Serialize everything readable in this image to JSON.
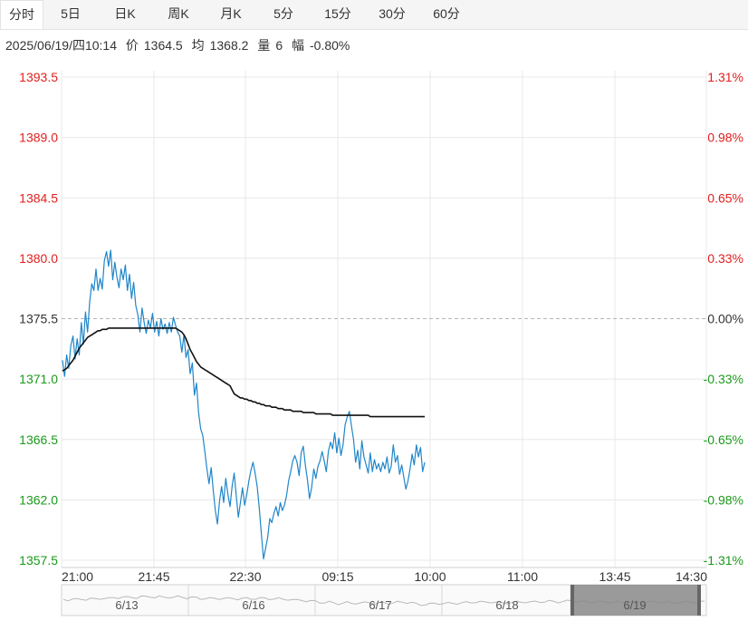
{
  "tabs": [
    {
      "label": "分时",
      "active": true
    },
    {
      "label": "5日",
      "active": false
    },
    {
      "label": "日K",
      "active": false
    },
    {
      "label": "周K",
      "active": false
    },
    {
      "label": "月K",
      "active": false
    },
    {
      "label": "5分",
      "active": false
    },
    {
      "label": "15分",
      "active": false
    },
    {
      "label": "30分",
      "active": false
    },
    {
      "label": "60分",
      "active": false
    }
  ],
  "info": {
    "datetime": "2025/06/19/四10:14",
    "price_label": "价",
    "price": "1364.5",
    "avg_label": "均",
    "avg": "1368.2",
    "vol_label": "量",
    "vol": "6",
    "change_label": "幅",
    "change": "-0.80%"
  },
  "colors": {
    "up": "#e0201e",
    "down": "#1a9a1a",
    "flat": "#333333",
    "price_line": "#1f86c9",
    "avg_line": "#111111",
    "grid": "#e8e8e8",
    "navigator_fill": "#888888"
  },
  "chart_data": {
    "type": "line",
    "prev_close": 1375.5,
    "ylim": [
      1357.5,
      1393.5
    ],
    "y_ticks_left": [
      "1393.5",
      "1389.0",
      "1384.5",
      "1380.0",
      "1375.5",
      "1371.0",
      "1366.5",
      "1362.0",
      "1357.5"
    ],
    "y_ticks_right": [
      "1.31%",
      "0.98%",
      "0.65%",
      "0.33%",
      "0.00%",
      "-0.33%",
      "-0.65%",
      "-0.98%",
      "-1.31%"
    ],
    "x_ticks": [
      "21:00",
      "21:45",
      "22:30",
      "09:15",
      "10:00",
      "11:00",
      "13:45",
      "14:30"
    ],
    "navigator_labels": [
      "6/13",
      "6/16",
      "6/17",
      "6/18",
      "6/19"
    ],
    "series": [
      {
        "values": [
          1372.4,
          1371.2,
          1372.8,
          1371.8,
          1373.5,
          1374.2,
          1372.5,
          1374.0,
          1372.8,
          1375.2,
          1373.6,
          1376.0,
          1374.5,
          1376.8,
          1378.1,
          1377.6,
          1379.2,
          1377.6,
          1378.5,
          1377.7,
          1379.8,
          1380.5,
          1379.4,
          1380.6,
          1378.4,
          1379.7,
          1378.6,
          1377.8,
          1379.2,
          1378.4,
          1379.5,
          1377.6,
          1378.8,
          1377.0,
          1378.2,
          1376.5,
          1375.8,
          1374.5,
          1376.3,
          1375.2,
          1374.4,
          1375.4,
          1374.8,
          1375.9,
          1374.5,
          1375.3,
          1374.2,
          1375.5,
          1374.7,
          1375.1,
          1374.4,
          1375.2,
          1374.5,
          1375.6,
          1375.0,
          1374.5,
          1374.2,
          1373.0,
          1374.3,
          1372.6,
          1373.2,
          1371.4,
          1372.2,
          1369.8,
          1370.7,
          1368.5,
          1367.3,
          1366.8,
          1365.6,
          1364.3,
          1363.2,
          1364.4,
          1362.7,
          1361.2,
          1360.2,
          1361.9,
          1363.0,
          1361.8,
          1363.6,
          1362.4,
          1361.5,
          1363.0,
          1364.0,
          1362.3,
          1360.7,
          1361.8,
          1362.9,
          1361.6,
          1362.4,
          1363.4,
          1364.2,
          1364.8,
          1364.0,
          1363.0,
          1361.4,
          1359.4,
          1357.6,
          1358.4,
          1359.2,
          1360.6,
          1360.3,
          1361.0,
          1361.5,
          1360.8,
          1361.8,
          1361.2,
          1361.6,
          1362.3,
          1363.4,
          1364.1,
          1364.9,
          1365.3,
          1364.8,
          1363.8,
          1365.5,
          1366.0,
          1364.6,
          1363.5,
          1362.1,
          1362.9,
          1364.3,
          1363.6,
          1364.5,
          1364.9,
          1365.6,
          1364.9,
          1364.1,
          1365.6,
          1366.3,
          1365.8,
          1367.0,
          1365.5,
          1366.6,
          1365.3,
          1366.1,
          1367.6,
          1368.2,
          1368.6,
          1367.5,
          1366.5,
          1364.8,
          1365.7,
          1364.3,
          1366.4,
          1365.2,
          1364.6,
          1364.0,
          1365.5,
          1364.1,
          1365.0,
          1364.3,
          1364.7,
          1364.1,
          1364.8,
          1364.3,
          1365.2,
          1364.0,
          1364.5,
          1366.1,
          1364.8,
          1365.3,
          1363.9,
          1364.6,
          1363.7,
          1362.8,
          1363.4,
          1364.3,
          1365.4,
          1364.6,
          1366.1,
          1365.2,
          1365.9,
          1364.1,
          1364.8
        ]
      },
      {
        "values": [
          1371.6,
          1371.7,
          1371.8,
          1372.0,
          1372.2,
          1372.4,
          1372.7,
          1373.0,
          1373.3,
          1373.5,
          1373.7,
          1373.9,
          1374.1,
          1374.2,
          1374.3,
          1374.4,
          1374.5,
          1374.6,
          1374.6,
          1374.7,
          1374.7,
          1374.7,
          1374.8,
          1374.8,
          1374.8,
          1374.8,
          1374.8,
          1374.8,
          1374.8,
          1374.8,
          1374.8,
          1374.8,
          1374.8,
          1374.8,
          1374.8,
          1374.8,
          1374.8,
          1374.8,
          1374.8,
          1374.8,
          1374.8,
          1374.8,
          1374.8,
          1374.8,
          1374.8,
          1374.8,
          1374.8,
          1374.8,
          1374.8,
          1374.8,
          1374.8,
          1374.8,
          1374.8,
          1374.8,
          1374.8,
          1374.7,
          1374.6,
          1374.5,
          1374.3,
          1374.0,
          1373.6,
          1373.2,
          1372.9,
          1372.6,
          1372.3,
          1372.1,
          1371.9,
          1371.8,
          1371.7,
          1371.6,
          1371.5,
          1371.4,
          1371.3,
          1371.2,
          1371.1,
          1371.0,
          1370.9,
          1370.8,
          1370.7,
          1370.6,
          1370.5,
          1370.2,
          1369.9,
          1369.8,
          1369.7,
          1369.6,
          1369.6,
          1369.5,
          1369.5,
          1369.4,
          1369.4,
          1369.3,
          1369.3,
          1369.2,
          1369.2,
          1369.1,
          1369.1,
          1369.0,
          1369.0,
          1369.0,
          1368.9,
          1368.9,
          1368.9,
          1368.8,
          1368.8,
          1368.8,
          1368.7,
          1368.7,
          1368.7,
          1368.7,
          1368.6,
          1368.6,
          1368.6,
          1368.6,
          1368.6,
          1368.5,
          1368.5,
          1368.5,
          1368.5,
          1368.5,
          1368.5,
          1368.4,
          1368.4,
          1368.4,
          1368.4,
          1368.4,
          1368.4,
          1368.4,
          1368.4,
          1368.3,
          1368.3,
          1368.3,
          1368.3,
          1368.3,
          1368.3,
          1368.3,
          1368.3,
          1368.3,
          1368.3,
          1368.3,
          1368.3,
          1368.3,
          1368.3,
          1368.3,
          1368.3,
          1368.3,
          1368.3,
          1368.2,
          1368.2,
          1368.2,
          1368.2,
          1368.2,
          1368.2,
          1368.2,
          1368.2,
          1368.2,
          1368.2,
          1368.2,
          1368.2,
          1368.2,
          1368.2,
          1368.2,
          1368.2,
          1368.2,
          1368.2,
          1368.2,
          1368.2,
          1368.2,
          1368.2,
          1368.2,
          1368.2,
          1368.2,
          1368.2,
          1368.2
        ]
      }
    ]
  }
}
